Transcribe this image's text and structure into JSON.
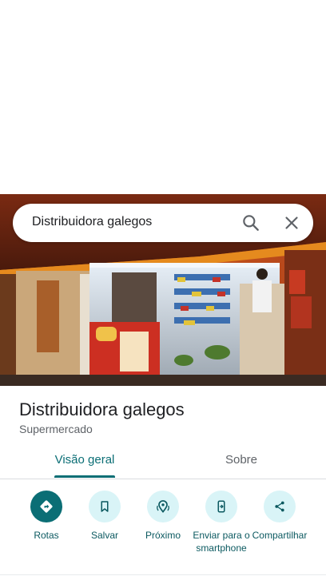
{
  "search": {
    "query": "Distribuidora galegos"
  },
  "place": {
    "name": "Distribuidora galegos",
    "category": "Supermercado"
  },
  "tabs": [
    {
      "label": "Visão geral",
      "active": true
    },
    {
      "label": "Sobre",
      "active": false
    }
  ],
  "actions": [
    {
      "label": "Rotas",
      "icon": "directions-icon"
    },
    {
      "label": "Salvar",
      "icon": "bookmark-icon"
    },
    {
      "label": "Próximo",
      "icon": "nearby-icon"
    },
    {
      "label": "Enviar para o smartphone",
      "icon": "send-to-phone-icon"
    },
    {
      "label": "Compartilhar",
      "icon": "share-icon"
    }
  ],
  "colors": {
    "accent": "#0b6e75",
    "chip_bg": "#d9f4f7",
    "text_primary": "#202124",
    "text_secondary": "#5f6368"
  }
}
